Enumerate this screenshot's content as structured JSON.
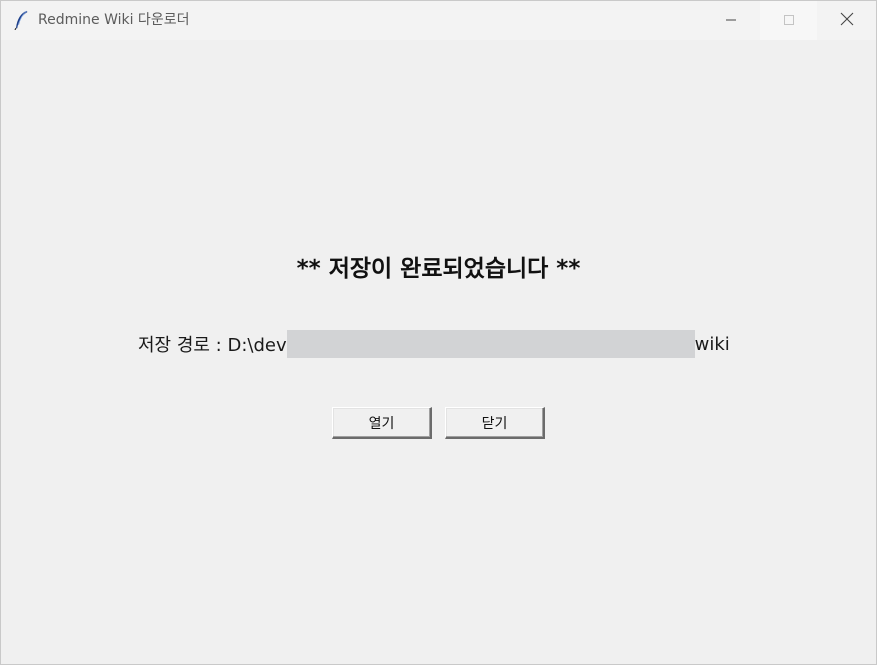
{
  "window": {
    "title": "Redmine Wiki 다운로더"
  },
  "titlebar": {
    "icons": [
      "feather-icon",
      "minimize-icon",
      "maximize-icon",
      "close-icon"
    ]
  },
  "main": {
    "headline": "** 저장이 완료되었습니다 **",
    "path_label": "저장 경로 : D:\\dev",
    "path_suffix": "wiki",
    "redacted_color": "#d2d3d5"
  },
  "buttons": {
    "open_label": "열기",
    "close_label": "닫기"
  }
}
